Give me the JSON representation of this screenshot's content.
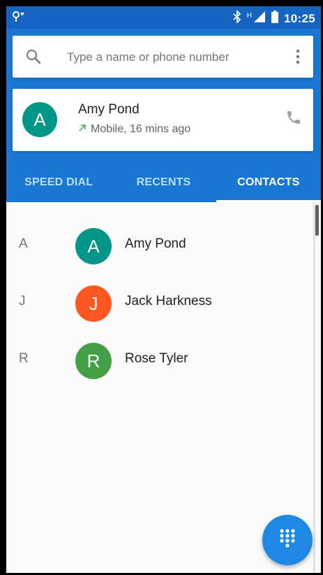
{
  "status_bar": {
    "network_label": "H",
    "time": "10:25"
  },
  "search": {
    "placeholder": "Type a name or phone number"
  },
  "recent_call": {
    "initial": "A",
    "name": "Amy Pond",
    "detail": "Mobile, 16 mins ago",
    "avatar_color": "#009688"
  },
  "tabs": [
    {
      "label": "SPEED DIAL",
      "active": false
    },
    {
      "label": "RECENTS",
      "active": false
    },
    {
      "label": "CONTACTS",
      "active": true
    }
  ],
  "contacts": [
    {
      "letter": "A",
      "initial": "A",
      "name": "Amy Pond",
      "color": "#009688"
    },
    {
      "letter": "J",
      "initial": "J",
      "name": "Jack Harkness",
      "color": "#ff5722"
    },
    {
      "letter": "R",
      "initial": "R",
      "name": "Rose Tyler",
      "color": "#43a047"
    }
  ],
  "colors": {
    "status_bar": "#1565c0",
    "app_bar": "#1976d2",
    "fab": "#1e88e5",
    "outgoing_arrow": "#4caf50"
  },
  "icons": {
    "status_left": "voicemail-icon",
    "bluetooth": "bluetooth-icon",
    "signal": "signal-icon",
    "battery": "battery-icon",
    "search": "search-icon",
    "overflow": "more-vert-icon",
    "call": "phone-icon",
    "outgoing": "outgoing-call-icon",
    "fab": "dialpad-icon"
  }
}
